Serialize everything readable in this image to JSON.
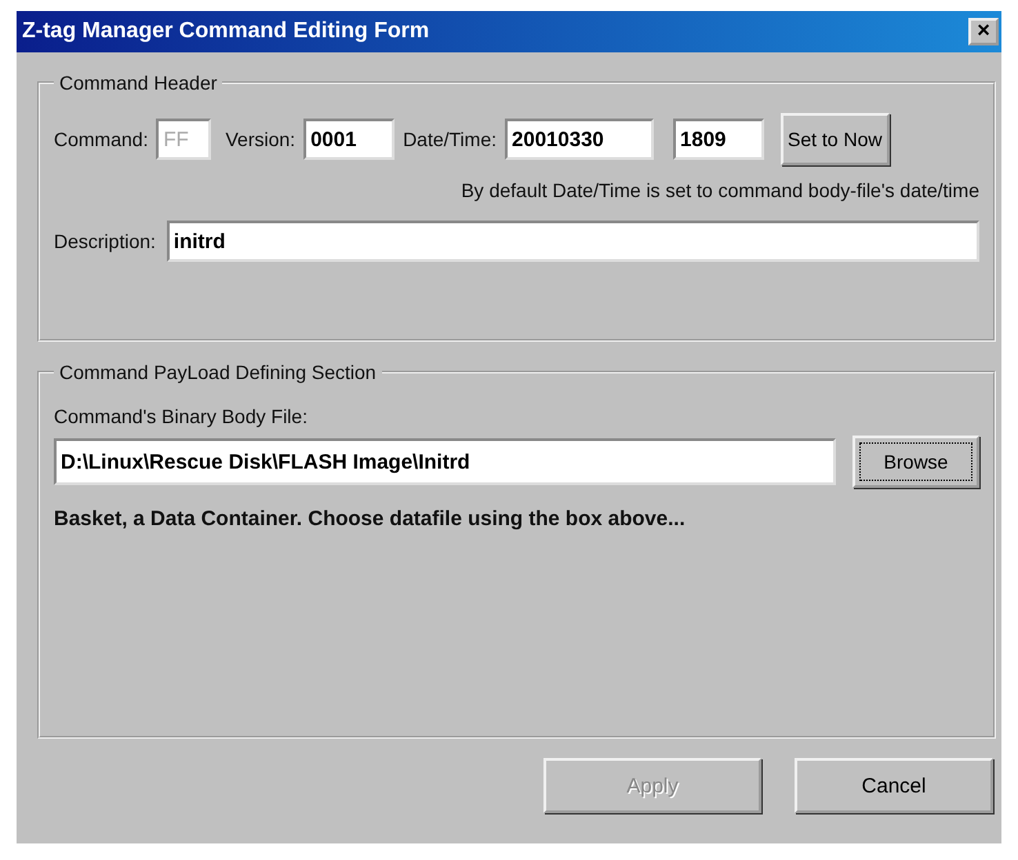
{
  "window": {
    "title": "Z-tag Manager Command Editing Form",
    "close": "×"
  },
  "header_group": {
    "title": "Command Header",
    "command": {
      "label": "Command:",
      "value": "FF",
      "disabled": true
    },
    "version": {
      "label": "Version:",
      "value": "0001"
    },
    "datetime": {
      "label": "Date/Time:",
      "date": "20010330",
      "time": "1809"
    },
    "set_now_button": {
      "label": "Set to Now",
      "disabled": false
    },
    "note": "By default Date/Time is set to command body-file's date/time",
    "description": {
      "label": "Description:",
      "value": "initrd"
    }
  },
  "payload_group": {
    "title": "Command PayLoad Defining Section",
    "file_label": "Command's Binary Body File:",
    "file_value": "D:\\Linux\\Rescue Disk\\FLASH Image\\Initrd",
    "browse_button": {
      "label": "Browse",
      "disabled": false,
      "focused": true
    },
    "info": "Basket, a Data Container. Choose datafile using the box above..."
  },
  "buttons": [
    {
      "label": "Apply",
      "disabled": true
    },
    {
      "label": "Cancel",
      "disabled": false
    }
  ]
}
